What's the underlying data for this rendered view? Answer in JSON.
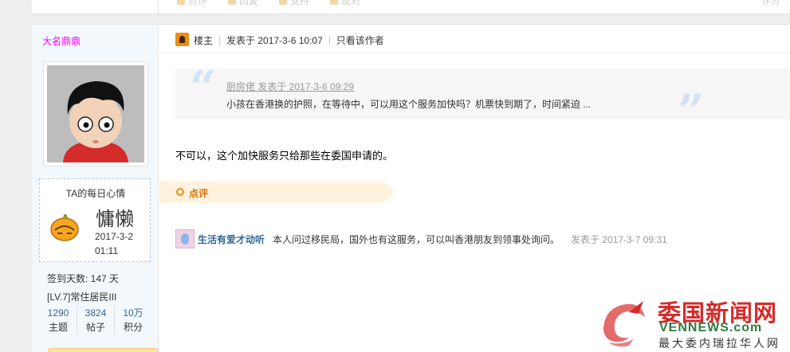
{
  "previous_post": {
    "actions": [
      "点评",
      "回复",
      "支持",
      "反对"
    ],
    "right_label": "评分"
  },
  "author": {
    "username": "大名鼎鼎",
    "mood_title": "TA的每日心情",
    "mood_word": "慵懒",
    "mood_date": "2017-3-2 01:11",
    "signin": "签到天数: 147 天",
    "level": "[LV.7]常住居民III",
    "stats": [
      {
        "value": "1290",
        "label": "主题"
      },
      {
        "value": "3824",
        "label": "帖子"
      },
      {
        "value": "10万",
        "label": "积分"
      }
    ]
  },
  "post": {
    "floor_label": "楼主",
    "posted_at": "发表于 2017-3-6 10:07",
    "only_author": "只看该作者",
    "quote_author": "厨房佬 发表于 2017-3-6 09:29",
    "quote_text": "小孩在香港换的护照，在等待中，可以用这个服务加快吗？机票快到期了，时间紧迫 ...",
    "message": "不可以，这个加快服务只给那些在委国申请的。",
    "comment_tab": "点评",
    "comment": {
      "user": "生活有爱才动听",
      "text": "本人问过移民局，国外也有这服务，可以叫香港朋友到领事处询问。",
      "time": "发表于 2017-3-7 09:31"
    }
  },
  "watermark": {
    "title": "委国新闻网",
    "url": "VENNEWS.com",
    "tagline": "最大委内瑞拉华人网"
  },
  "colors": {
    "username": "#ff00ff",
    "link": "#336699",
    "accent": "#f08a14",
    "watermark_red": "#d42a2a",
    "watermark_green": "#2e7a3e"
  }
}
